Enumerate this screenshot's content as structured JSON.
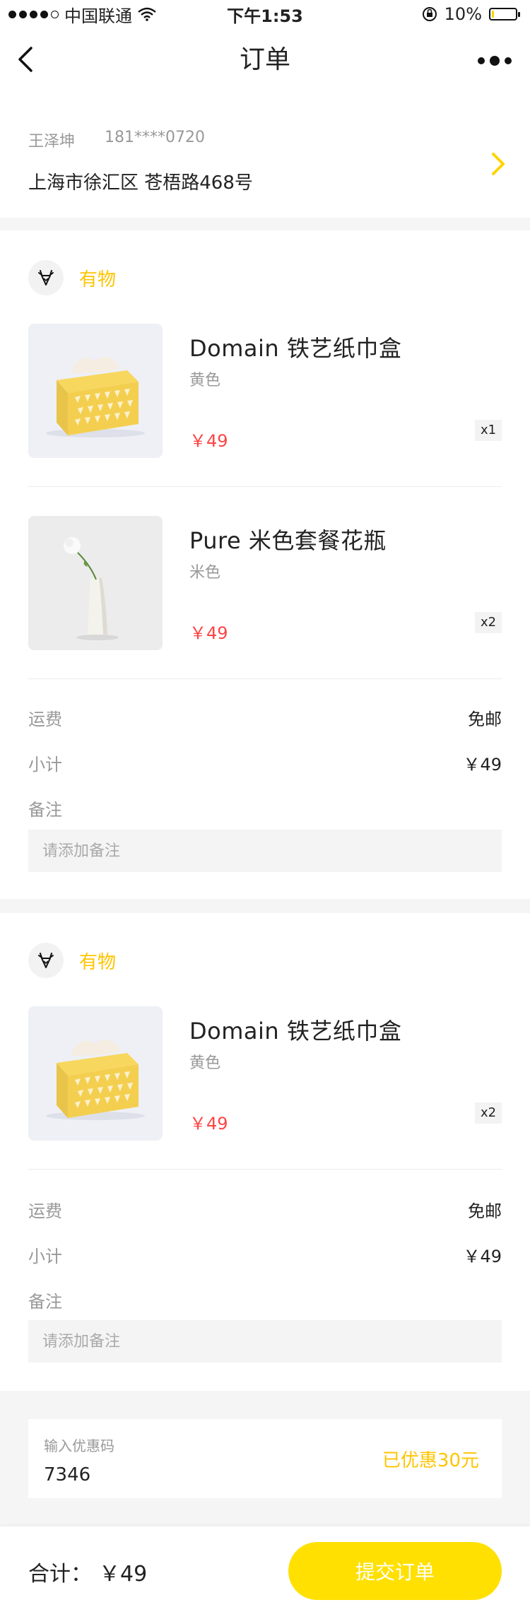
{
  "status_bar": {
    "carrier": "中国联通",
    "time": "下午1:53",
    "battery_text": "10%",
    "battery_level": 0.1
  },
  "nav": {
    "title": "订单"
  },
  "address": {
    "name": "王泽坤",
    "phone": "181****0720",
    "line": "上海市徐汇区 苍梧路468号"
  },
  "orders": [
    {
      "shop_name": "有物",
      "items": [
        {
          "name": "Domain 铁艺纸巾盒",
          "spec": "黄色",
          "price": "￥49",
          "qty": "x1"
        },
        {
          "name": "Pure 米色套餐花瓶",
          "spec": "米色",
          "price": "￥49",
          "qty": "x2"
        }
      ],
      "shipping_label": "运费",
      "shipping_value": "免邮",
      "subtotal_label": "小计",
      "subtotal_value": "￥49",
      "remark_label": "备注",
      "remark_placeholder": "请添加备注"
    },
    {
      "shop_name": "有物",
      "items": [
        {
          "name": "Domain 铁艺纸巾盒",
          "spec": "黄色",
          "price": "￥49",
          "qty": "x2"
        }
      ],
      "shipping_label": "运费",
      "shipping_value": "免邮",
      "subtotal_label": "小计",
      "subtotal_value": "￥49",
      "remark_label": "备注",
      "remark_placeholder": "请添加备注"
    }
  ],
  "coupon": {
    "label": "输入优惠码",
    "code": "7346",
    "discount": "已优惠30元"
  },
  "footer": {
    "total_label": "合计：",
    "total_value": "￥49",
    "submit_label": "提交订单"
  },
  "colors": {
    "accent": "#FFE000",
    "accent_text": "#FFC400",
    "price": "#FF4444",
    "background": "#F5F5F5"
  }
}
